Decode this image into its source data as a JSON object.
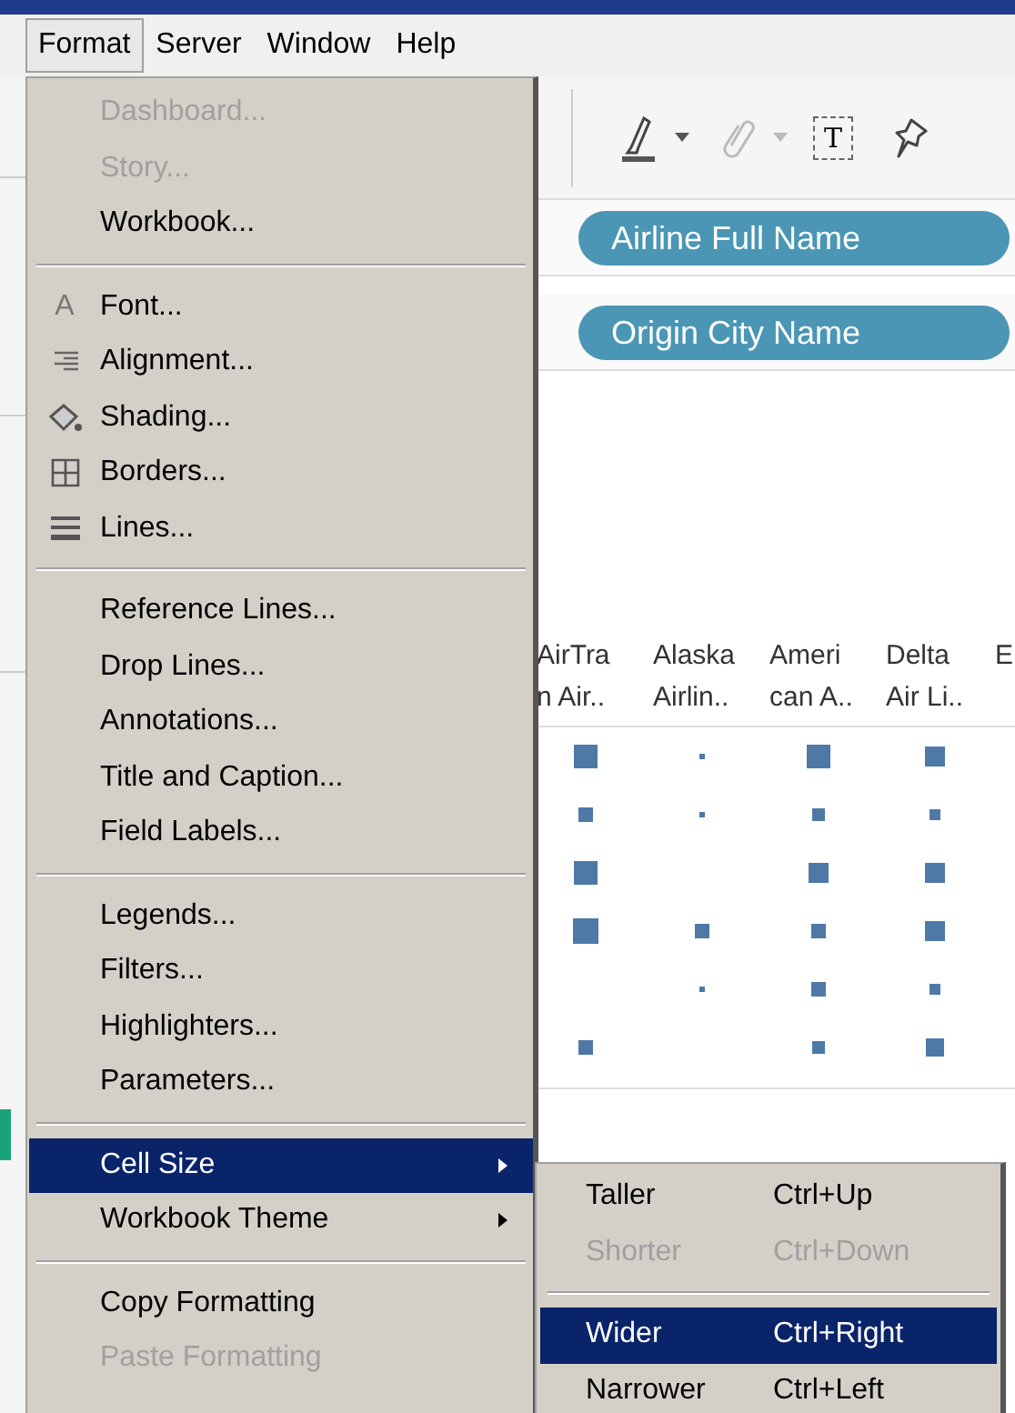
{
  "menubar": [
    {
      "label": "Format",
      "selected": true
    },
    {
      "label": "Server",
      "selected": false
    },
    {
      "label": "Window",
      "selected": false
    },
    {
      "label": "Help",
      "selected": false
    }
  ],
  "toolbar": {
    "text_tool": "T"
  },
  "shelves": [
    {
      "pill": "Airline Full Name"
    },
    {
      "pill": "Origin City Name"
    }
  ],
  "view": {
    "headers": [
      {
        "lines": [
          "AirTra",
          "n Air.."
        ]
      },
      {
        "lines": [
          "Alaska",
          "Airlin.."
        ]
      },
      {
        "lines": [
          "Ameri",
          "can A.."
        ]
      },
      {
        "lines": [
          "Delta",
          "Air Li.."
        ]
      },
      {
        "lines": [
          "E"
        ]
      }
    ]
  },
  "format_menu": [
    {
      "kind": "item",
      "label": "Dashboard...",
      "disabled": true,
      "selected": false,
      "submenu": false
    },
    {
      "kind": "item",
      "label": "Story...",
      "disabled": true,
      "selected": false,
      "submenu": false
    },
    {
      "kind": "item",
      "label": "Workbook...",
      "disabled": false,
      "selected": false,
      "submenu": false
    },
    {
      "kind": "separator"
    },
    {
      "kind": "item",
      "label": "Font...",
      "disabled": false,
      "selected": false,
      "submenu": false,
      "icon": {
        "kind": "letter",
        "text": "A"
      }
    },
    {
      "kind": "item",
      "label": "Alignment...",
      "disabled": false,
      "selected": false,
      "submenu": false,
      "icon": {
        "kind": "align"
      }
    },
    {
      "kind": "item",
      "label": "Shading...",
      "disabled": false,
      "selected": false,
      "submenu": false,
      "icon": {
        "kind": "shading"
      }
    },
    {
      "kind": "item",
      "label": "Borders...",
      "disabled": false,
      "selected": false,
      "submenu": false,
      "icon": {
        "kind": "borders"
      }
    },
    {
      "kind": "item",
      "label": "Lines...",
      "disabled": false,
      "selected": false,
      "submenu": false,
      "icon": {
        "kind": "lines"
      }
    },
    {
      "kind": "separator"
    },
    {
      "kind": "item",
      "label": "Reference Lines...",
      "disabled": false,
      "selected": false,
      "submenu": false
    },
    {
      "kind": "item",
      "label": "Drop Lines...",
      "disabled": false,
      "selected": false,
      "submenu": false
    },
    {
      "kind": "item",
      "label": "Annotations...",
      "disabled": false,
      "selected": false,
      "submenu": false
    },
    {
      "kind": "item",
      "label": "Title and Caption...",
      "disabled": false,
      "selected": false,
      "submenu": false
    },
    {
      "kind": "item",
      "label": "Field Labels...",
      "disabled": false,
      "selected": false,
      "submenu": false
    },
    {
      "kind": "separator"
    },
    {
      "kind": "item",
      "label": "Legends...",
      "disabled": false,
      "selected": false,
      "submenu": false
    },
    {
      "kind": "item",
      "label": "Filters...",
      "disabled": false,
      "selected": false,
      "submenu": false
    },
    {
      "kind": "item",
      "label": "Highlighters...",
      "disabled": false,
      "selected": false,
      "submenu": false
    },
    {
      "kind": "item",
      "label": "Parameters...",
      "disabled": false,
      "selected": false,
      "submenu": false
    },
    {
      "kind": "separator"
    },
    {
      "kind": "item",
      "label": "Cell Size",
      "disabled": false,
      "selected": true,
      "submenu": true
    },
    {
      "kind": "item",
      "label": "Workbook Theme",
      "disabled": false,
      "selected": false,
      "submenu": true
    },
    {
      "kind": "separator"
    },
    {
      "kind": "item",
      "label": "Copy Formatting",
      "disabled": false,
      "selected": false,
      "submenu": false
    },
    {
      "kind": "item",
      "label": "Paste Formatting",
      "disabled": true,
      "selected": false,
      "submenu": false
    }
  ],
  "cell_size_menu": [
    {
      "kind": "item",
      "label": "Taller",
      "shortcut": "Ctrl+Up",
      "disabled": false,
      "selected": false
    },
    {
      "kind": "item",
      "label": "Shorter",
      "shortcut": "Ctrl+Down",
      "disabled": true,
      "selected": false
    },
    {
      "kind": "separator"
    },
    {
      "kind": "item",
      "label": "Wider",
      "shortcut": "Ctrl+Right",
      "disabled": false,
      "selected": true
    },
    {
      "kind": "item",
      "label": "Narrower",
      "shortcut": "Ctrl+Left",
      "disabled": false,
      "selected": false
    }
  ]
}
